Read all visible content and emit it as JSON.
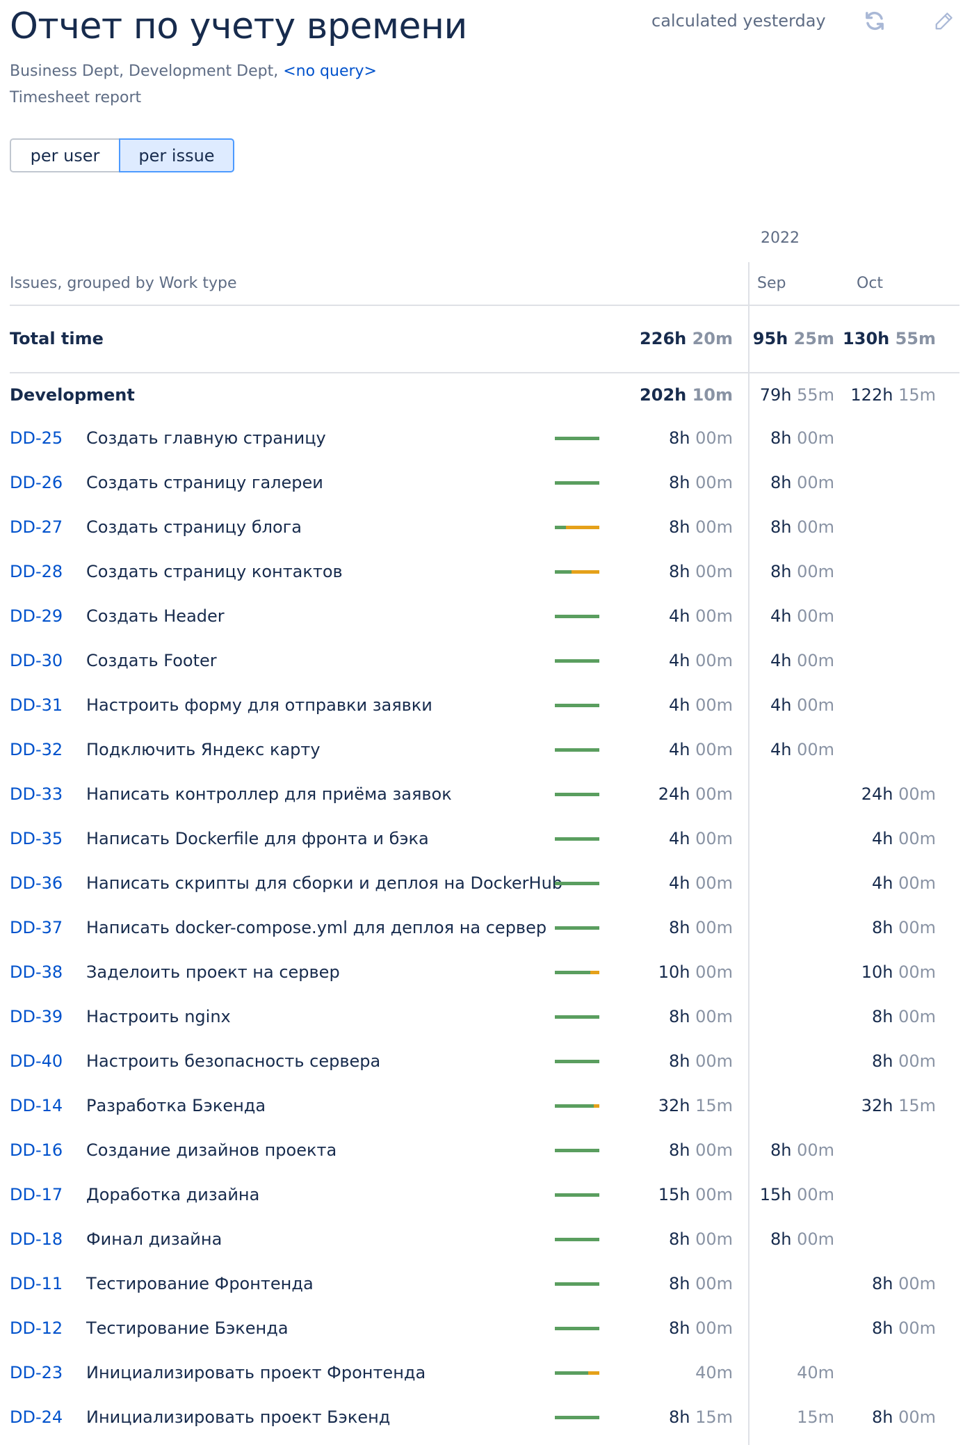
{
  "header": {
    "title": "Отчет по учету времени",
    "calculated": "calculated yesterday",
    "filters_text": "Business Dept, Development Dept,",
    "query_link": "<no query>",
    "report_type": "Timesheet report"
  },
  "toggle": {
    "per_user": "per user",
    "per_issue": "per issue",
    "selected": "per issue"
  },
  "table": {
    "group_header": "Issues, grouped by Work type",
    "year": "2022",
    "months": [
      "Sep",
      "Oct"
    ],
    "total": {
      "label": "Total time",
      "all": {
        "h": "226h",
        "m": "20m"
      },
      "sep": {
        "h": "95h",
        "m": "25m"
      },
      "oct": {
        "h": "130h",
        "m": "55m"
      }
    },
    "group": {
      "label": "Development",
      "all": {
        "h": "202h",
        "m": "10m"
      },
      "sep": {
        "h": "79h",
        "m": "55m"
      },
      "oct": {
        "h": "122h",
        "m": "15m"
      }
    },
    "rows": [
      {
        "key": "DD-25",
        "summary": "Создать главную страницу",
        "bar_green": 1.0,
        "all": {
          "h": "8h",
          "m": "00m"
        },
        "sep": {
          "h": "8h",
          "m": "00m"
        },
        "oct": null
      },
      {
        "key": "DD-26",
        "summary": "Создать страницу галереи",
        "bar_green": 1.0,
        "all": {
          "h": "8h",
          "m": "00m"
        },
        "sep": {
          "h": "8h",
          "m": "00m"
        },
        "oct": null
      },
      {
        "key": "DD-27",
        "summary": "Создать страницу блога",
        "bar_green": 0.25,
        "all": {
          "h": "8h",
          "m": "00m"
        },
        "sep": {
          "h": "8h",
          "m": "00m"
        },
        "oct": null
      },
      {
        "key": "DD-28",
        "summary": "Создать страницу контактов",
        "bar_green": 0.38,
        "all": {
          "h": "8h",
          "m": "00m"
        },
        "sep": {
          "h": "8h",
          "m": "00m"
        },
        "oct": null
      },
      {
        "key": "DD-29",
        "summary": "Создать Header",
        "bar_green": 1.0,
        "all": {
          "h": "4h",
          "m": "00m"
        },
        "sep": {
          "h": "4h",
          "m": "00m"
        },
        "oct": null
      },
      {
        "key": "DD-30",
        "summary": "Создать Footer",
        "bar_green": 1.0,
        "all": {
          "h": "4h",
          "m": "00m"
        },
        "sep": {
          "h": "4h",
          "m": "00m"
        },
        "oct": null
      },
      {
        "key": "DD-31",
        "summary": "Настроить форму для отправки заявки",
        "bar_green": 1.0,
        "all": {
          "h": "4h",
          "m": "00m"
        },
        "sep": {
          "h": "4h",
          "m": "00m"
        },
        "oct": null
      },
      {
        "key": "DD-32",
        "summary": "Подключить Яндекс карту",
        "bar_green": 1.0,
        "all": {
          "h": "4h",
          "m": "00m"
        },
        "sep": {
          "h": "4h",
          "m": "00m"
        },
        "oct": null
      },
      {
        "key": "DD-33",
        "summary": "Написать контроллер для приёма заявок",
        "bar_green": 1.0,
        "all": {
          "h": "24h",
          "m": "00m"
        },
        "sep": null,
        "oct": {
          "h": "24h",
          "m": "00m"
        }
      },
      {
        "key": "DD-35",
        "summary": "Написать Dockerfile для фронта и бэка",
        "bar_green": 1.0,
        "all": {
          "h": "4h",
          "m": "00m"
        },
        "sep": null,
        "oct": {
          "h": "4h",
          "m": "00m"
        }
      },
      {
        "key": "DD-36",
        "summary": "Написать скрипты для сборки и деплоя на DockerHub",
        "bar_green": 1.0,
        "all": {
          "h": "4h",
          "m": "00m"
        },
        "sep": null,
        "oct": {
          "h": "4h",
          "m": "00m"
        }
      },
      {
        "key": "DD-37",
        "summary": "Написать docker-compose.yml для деплоя на сервер",
        "bar_green": 1.0,
        "all": {
          "h": "8h",
          "m": "00m"
        },
        "sep": null,
        "oct": {
          "h": "8h",
          "m": "00m"
        }
      },
      {
        "key": "DD-38",
        "summary": "Заделоить проект на сервер",
        "bar_green": 0.8,
        "all": {
          "h": "10h",
          "m": "00m"
        },
        "sep": null,
        "oct": {
          "h": "10h",
          "m": "00m"
        }
      },
      {
        "key": "DD-39",
        "summary": "Настроить nginx",
        "bar_green": 1.0,
        "all": {
          "h": "8h",
          "m": "00m"
        },
        "sep": null,
        "oct": {
          "h": "8h",
          "m": "00m"
        }
      },
      {
        "key": "DD-40",
        "summary": "Настроить безопасность сервера",
        "bar_green": 1.0,
        "all": {
          "h": "8h",
          "m": "00m"
        },
        "sep": null,
        "oct": {
          "h": "8h",
          "m": "00m"
        }
      },
      {
        "key": "DD-14",
        "summary": "Разработка Бэкенда",
        "bar_green": 0.88,
        "all": {
          "h": "32h",
          "m": "15m"
        },
        "sep": null,
        "oct": {
          "h": "32h",
          "m": "15m"
        }
      },
      {
        "key": "DD-16",
        "summary": "Создание дизайнов проекта",
        "bar_green": 1.0,
        "all": {
          "h": "8h",
          "m": "00m"
        },
        "sep": {
          "h": "8h",
          "m": "00m"
        },
        "oct": null
      },
      {
        "key": "DD-17",
        "summary": "Доработка дизайна",
        "bar_green": 1.0,
        "all": {
          "h": "15h",
          "m": "00m"
        },
        "sep": {
          "h": "15h",
          "m": "00m"
        },
        "oct": null
      },
      {
        "key": "DD-18",
        "summary": "Финал дизайна",
        "bar_green": 1.0,
        "all": {
          "h": "8h",
          "m": "00m"
        },
        "sep": {
          "h": "8h",
          "m": "00m"
        },
        "oct": null
      },
      {
        "key": "DD-11",
        "summary": "Тестирование Фронтенда",
        "bar_green": 1.0,
        "all": {
          "h": "8h",
          "m": "00m"
        },
        "sep": null,
        "oct": {
          "h": "8h",
          "m": "00m"
        }
      },
      {
        "key": "DD-12",
        "summary": "Тестирование Бэкенда",
        "bar_green": 1.0,
        "all": {
          "h": "8h",
          "m": "00m"
        },
        "sep": null,
        "oct": {
          "h": "8h",
          "m": "00m"
        }
      },
      {
        "key": "DD-23",
        "summary": "Инициализировать проект Фронтенда",
        "bar_green": 0.75,
        "all": {
          "h": "",
          "m": "40m"
        },
        "sep": {
          "h": "",
          "m": "40m"
        },
        "oct": null
      },
      {
        "key": "DD-24",
        "summary": "Инициализировать проект Бэкенд",
        "bar_green": 1.0,
        "all": {
          "h": "8h",
          "m": "15m"
        },
        "sep": {
          "h": "",
          "m": "15m"
        },
        "oct": {
          "h": "8h",
          "m": "00m"
        }
      }
    ]
  },
  "colors": {
    "bar_green": "#5a9e5f",
    "bar_orange": "#e5a11a",
    "link": "#0052cc"
  },
  "icons": {
    "refresh": "refresh-icon",
    "edit": "pencil-icon"
  }
}
